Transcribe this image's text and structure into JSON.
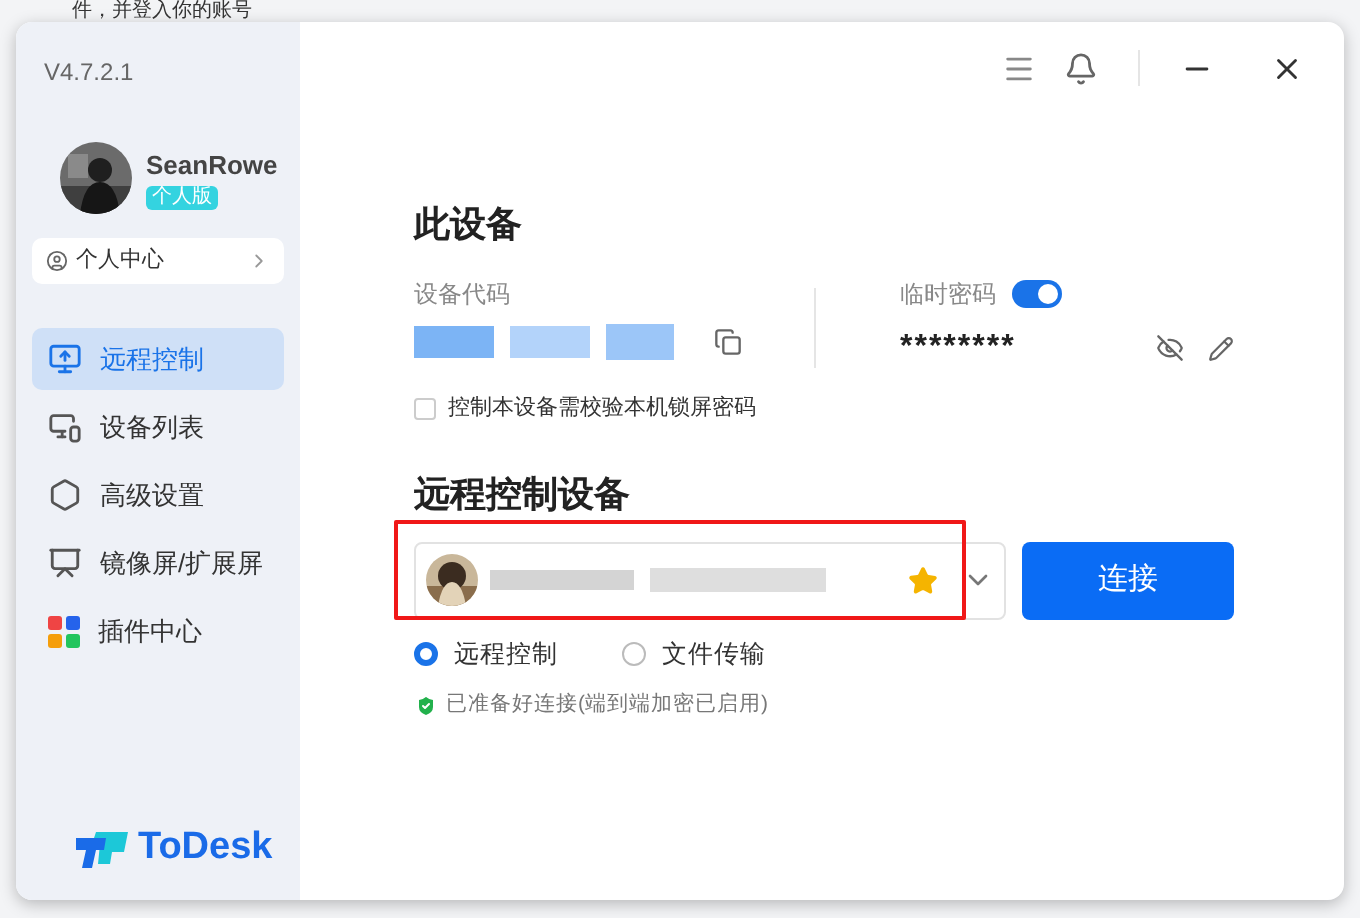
{
  "background_text": "件，并登入你的账号",
  "window": {
    "version": "V4.7.2.1"
  },
  "user": {
    "name": "SeanRowe",
    "badge": "个人版",
    "profile_link": "个人中心"
  },
  "sidebar": {
    "items": [
      {
        "label": "远程控制",
        "selected": true
      },
      {
        "label": "设备列表",
        "selected": false
      },
      {
        "label": "高级设置",
        "selected": false
      },
      {
        "label": "镜像屏/扩展屏",
        "selected": false
      },
      {
        "label": "插件中心",
        "selected": false
      }
    ]
  },
  "logo": "ToDesk",
  "this_device": {
    "title": "此设备",
    "code_label": "设备代码",
    "password_label": "临时密码",
    "password_on": true,
    "password": "********",
    "lock_check": {
      "label": "控制本设备需校验本机锁屏密码",
      "checked": false
    }
  },
  "remote": {
    "title": "远程控制设备",
    "favorite": true,
    "connect": "连接",
    "modes": [
      {
        "label": "远程控制",
        "selected": true
      },
      {
        "label": "文件传输",
        "selected": false
      }
    ],
    "status": "已准备好连接(端到端加密已启用)"
  }
}
